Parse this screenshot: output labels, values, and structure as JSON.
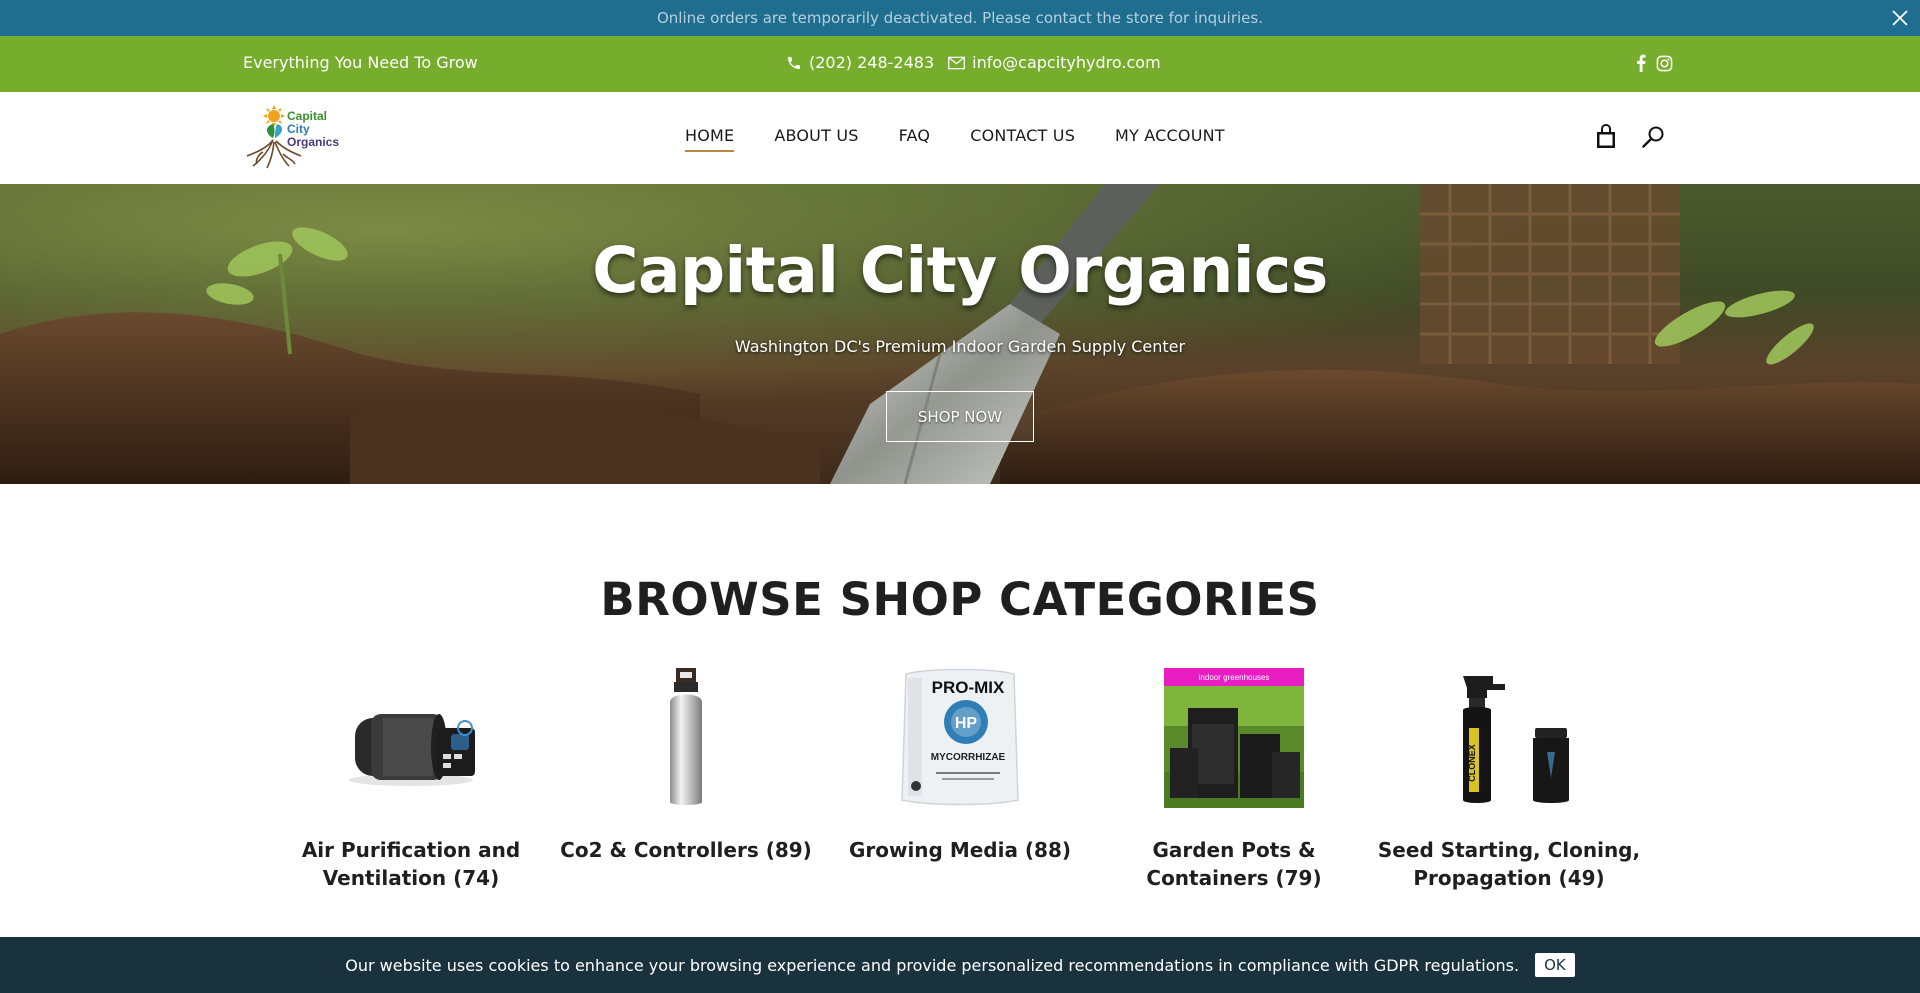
{
  "notice": {
    "text": "Online orders are temporarily deactivated. Please contact the store for inquiries."
  },
  "topbar": {
    "tagline": "Everything You Need To Grow",
    "phone": "(202) 248-2483",
    "email": "info@capcityhydro.com",
    "background": "#76ad2c"
  },
  "logo": {
    "line1": "Capital",
    "line2": "City",
    "line3": "Organics"
  },
  "nav": {
    "items": [
      {
        "label": "HOME"
      },
      {
        "label": "ABOUT US"
      },
      {
        "label": "FAQ"
      },
      {
        "label": "CONTACT US"
      },
      {
        "label": "MY ACCOUNT"
      }
    ]
  },
  "hero": {
    "title": "Capital City Organics",
    "subtitle": "Washington DC's Premium Indoor Garden Supply Center",
    "button": "SHOP NOW"
  },
  "categories": {
    "title": "BROWSE SHOP CATEGORIES",
    "items": [
      {
        "label": "Air Purification and Ventilation (74)",
        "image": "inline-fan-icon"
      },
      {
        "label": "Co2 & Controllers (89)",
        "image": "co2-tank-icon"
      },
      {
        "label": "Growing Media (88)",
        "image": "promix-bag-icon"
      },
      {
        "label": "Garden Pots & Containers (79)",
        "image": "grow-tent-icon"
      },
      {
        "label": "Seed Starting, Cloning, Propagation (49)",
        "image": "clonex-bottles-icon"
      }
    ],
    "promix_text": {
      "brand": "PRO-MIX",
      "badge": "HP",
      "line": "MYCORRHIZAE"
    },
    "tent_banner": "indoor greenhouses",
    "clonex_text": "CLONEX"
  },
  "cookie": {
    "text": "Our website uses cookies to enhance your browsing experience and provide personalized recommendations in compliance with GDPR regulations.",
    "button": "OK"
  },
  "colors": {
    "notice_bg": "#1f6e8f",
    "topbar_bg": "#76ad2c",
    "cookie_bg": "#19323e",
    "nav_active_underline": "#b58a3a"
  }
}
